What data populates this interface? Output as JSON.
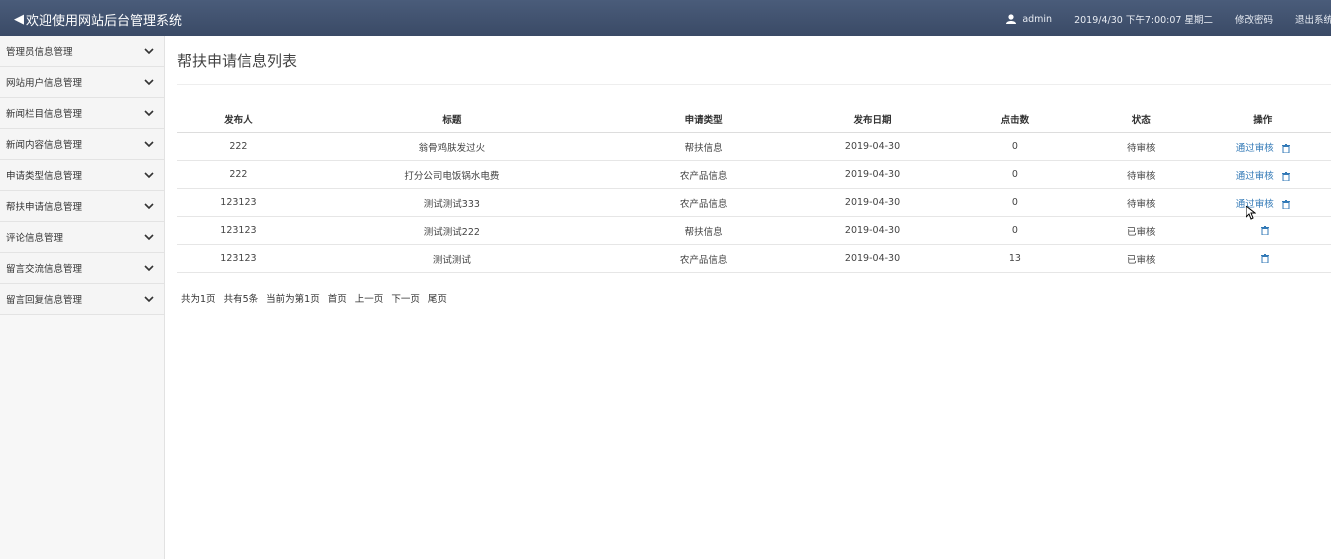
{
  "header": {
    "title": "欢迎使用网站后台管理系统",
    "user": "admin",
    "datetime": "2019/4/30 下午7:00:07 星期二",
    "change_password": "修改密码",
    "logout": "退出系统"
  },
  "sidebar": {
    "items": [
      {
        "label": "管理员信息管理"
      },
      {
        "label": "网站用户信息管理"
      },
      {
        "label": "新闻栏目信息管理"
      },
      {
        "label": "新闻内容信息管理"
      },
      {
        "label": "申请类型信息管理"
      },
      {
        "label": "帮扶申请信息管理"
      },
      {
        "label": "评论信息管理"
      },
      {
        "label": "留言交流信息管理"
      },
      {
        "label": "留言回复信息管理"
      }
    ]
  },
  "main": {
    "title": "帮扶申请信息列表",
    "columns": [
      "发布人",
      "标题",
      "申请类型",
      "发布日期",
      "点击数",
      "状态",
      "操作"
    ],
    "rows": [
      {
        "publisher": "222",
        "title": "翁骨鸡肤发过火",
        "type": "帮扶信息",
        "date": "2019-04-30",
        "clicks": "0",
        "status": "待审核",
        "action": "通过审核"
      },
      {
        "publisher": "222",
        "title": "打分公司电饭锅水电费",
        "type": "农产品信息",
        "date": "2019-04-30",
        "clicks": "0",
        "status": "待审核",
        "action": "通过审核"
      },
      {
        "publisher": "123123",
        "title": "测试测试333",
        "type": "农产品信息",
        "date": "2019-04-30",
        "clicks": "0",
        "status": "待审核",
        "action": "通过审核"
      },
      {
        "publisher": "123123",
        "title": "测试测试222",
        "type": "帮扶信息",
        "date": "2019-04-30",
        "clicks": "0",
        "status": "已审核",
        "action": ""
      },
      {
        "publisher": "123123",
        "title": "测试测试",
        "type": "农产品信息",
        "date": "2019-04-30",
        "clicks": "13",
        "status": "已审核",
        "action": ""
      }
    ],
    "pagination": {
      "total_pages": "共为1页",
      "total_items": "共有5条",
      "current": "当前为第1页",
      "first": "首页",
      "prev": "上一页",
      "next": "下一页",
      "last": "尾页"
    }
  },
  "colors": {
    "header_bg": "#3f5070",
    "link": "#337ab7"
  }
}
